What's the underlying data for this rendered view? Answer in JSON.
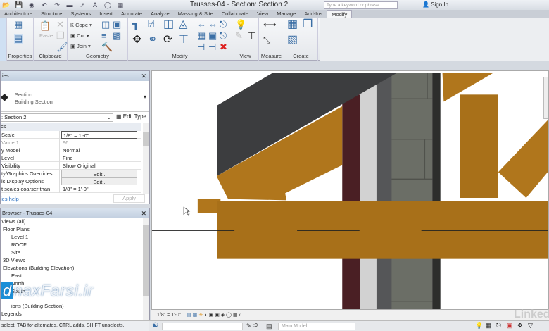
{
  "window": {
    "title": "Trusses-04 - Section: Section 2",
    "search_placeholder": "Type a keyword or phrase",
    "sign_in": "Sign In"
  },
  "tabs": [
    "Architecture",
    "Structure",
    "Systems",
    "Insert",
    "Annotate",
    "Analyze",
    "Massing & Site",
    "Collaborate",
    "View",
    "Manage",
    "Add-Ins",
    "Modify"
  ],
  "active_tab": "Modify",
  "ribbon": {
    "groups": [
      "Properties",
      "Clipboard",
      "Geometry",
      "Modify",
      "View",
      "Measure",
      "Create"
    ],
    "paste": "Paste",
    "cope": "Cope",
    "cut": "Cut",
    "join": "Join"
  },
  "properties": {
    "header": "ies",
    "type_name": "Section",
    "type_sub": "Building Section",
    "instance": ": Section 2",
    "edit_type": "Edit Type",
    "section": "cs",
    "rows": [
      {
        "k": "Scale",
        "v": "1/8\" = 1'-0\""
      },
      {
        "k": "Value    1:",
        "v": "96"
      },
      {
        "k": "y Model",
        "v": "Normal"
      },
      {
        "k": "Level",
        "v": "Fine"
      },
      {
        "k": "Visibility",
        "v": "Show Original"
      },
      {
        "k": "ty/Graphics Overrides",
        "v": "Edit..."
      },
      {
        "k": "ic Display Options",
        "v": "Edit..."
      },
      {
        "k": "t scales coarser than",
        "v": "1/8\" = 1'-0\""
      }
    ],
    "help": "ies help",
    "apply": "Apply"
  },
  "browser": {
    "header": "Browser - Trusses-04",
    "items": [
      "Views (all)",
      "Floor Plans",
      "Level 1",
      "ROOF",
      "Site",
      "3D Views",
      "Elevations (Building Elevation)",
      "East",
      "North",
      "South",
      "ions (Building Section)",
      "Legends"
    ]
  },
  "status": {
    "message": "select, TAB for alternates, CTRL adds, SHIFT unselects.",
    "scale": "1/8\" = 1'-0\"",
    "workset": "Main Model",
    "selection_count": ":0"
  },
  "watermark": {
    "d": "d",
    "text": "naxFarsi.ir"
  },
  "branding": "Linked",
  "colors": {
    "wood": "#b0761c",
    "roof": "#3c3d3f",
    "brick": "#4a1f24",
    "block": "#6b6e66"
  }
}
